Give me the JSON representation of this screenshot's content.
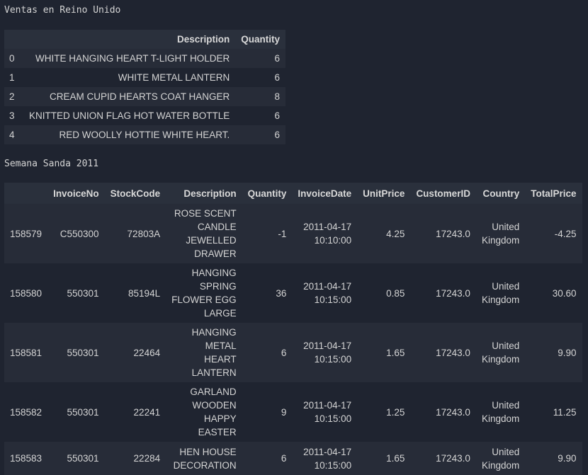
{
  "captions": {
    "uk_sales": "Ventas en Reino Unido",
    "holy_week": "Semana Sanda 2011"
  },
  "table1": {
    "columns": [
      "",
      "Description",
      "Quantity"
    ],
    "rows": [
      {
        "index": "0",
        "description": "WHITE HANGING HEART T-LIGHT HOLDER",
        "quantity": "6"
      },
      {
        "index": "1",
        "description": "WHITE METAL LANTERN",
        "quantity": "6"
      },
      {
        "index": "2",
        "description": "CREAM CUPID HEARTS COAT HANGER",
        "quantity": "8"
      },
      {
        "index": "3",
        "description": "KNITTED UNION FLAG HOT WATER BOTTLE",
        "quantity": "6"
      },
      {
        "index": "4",
        "description": "RED WOOLLY HOTTIE WHITE HEART.",
        "quantity": "6"
      }
    ]
  },
  "table2": {
    "columns": [
      "",
      "InvoiceNo",
      "StockCode",
      "Description",
      "Quantity",
      "InvoiceDate",
      "UnitPrice",
      "CustomerID",
      "Country",
      "TotalPrice"
    ],
    "rows": [
      {
        "index": "158579",
        "invoice_no": "C550300",
        "stock_code": "72803A",
        "description": [
          "ROSE SCENT",
          "CANDLE",
          "JEWELLED",
          "DRAWER"
        ],
        "quantity": "-1",
        "invoice_date": [
          "2011-04-17",
          "10:10:00"
        ],
        "unit_price": "4.25",
        "customer_id": "17243.0",
        "country": [
          "United",
          "Kingdom"
        ],
        "total_price": "-4.25"
      },
      {
        "index": "158580",
        "invoice_no": "550301",
        "stock_code": "85194L",
        "description": [
          "HANGING",
          "SPRING",
          "FLOWER EGG",
          "LARGE"
        ],
        "quantity": "36",
        "invoice_date": [
          "2011-04-17",
          "10:15:00"
        ],
        "unit_price": "0.85",
        "customer_id": "17243.0",
        "country": [
          "United",
          "Kingdom"
        ],
        "total_price": "30.60"
      },
      {
        "index": "158581",
        "invoice_no": "550301",
        "stock_code": "22464",
        "description": [
          "HANGING",
          "METAL",
          "HEART",
          "LANTERN"
        ],
        "quantity": "6",
        "invoice_date": [
          "2011-04-17",
          "10:15:00"
        ],
        "unit_price": "1.65",
        "customer_id": "17243.0",
        "country": [
          "United",
          "Kingdom"
        ],
        "total_price": "9.90"
      },
      {
        "index": "158582",
        "invoice_no": "550301",
        "stock_code": "22241",
        "description": [
          "GARLAND",
          "WOODEN",
          "HAPPY",
          "EASTER"
        ],
        "quantity": "9",
        "invoice_date": [
          "2011-04-17",
          "10:15:00"
        ],
        "unit_price": "1.25",
        "customer_id": "17243.0",
        "country": [
          "United",
          "Kingdom"
        ],
        "total_price": "11.25"
      },
      {
        "index": "158583",
        "invoice_no": "550301",
        "stock_code": "22284",
        "description": [
          "HEN HOUSE",
          "DECORATION"
        ],
        "quantity": "6",
        "invoice_date": [
          "2011-04-17",
          "10:15:00"
        ],
        "unit_price": "1.65",
        "customer_id": "17243.0",
        "country": [
          "United",
          "Kingdom"
        ],
        "total_price": "9.90"
      }
    ]
  }
}
